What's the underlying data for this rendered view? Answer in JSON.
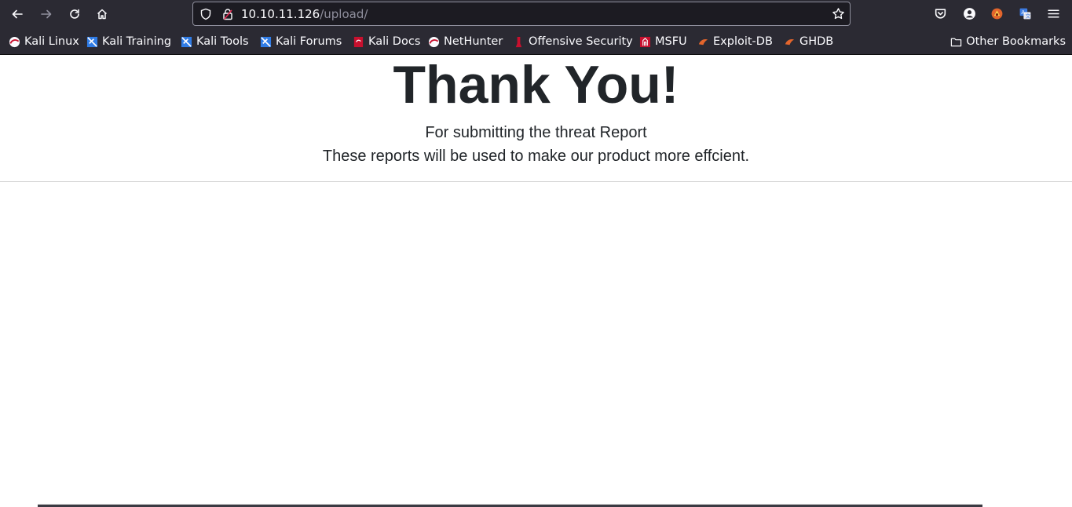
{
  "browser": {
    "url_host": "10.10.11.126",
    "url_path": "/upload/",
    "bookmarks": [
      {
        "label": "Kali Linux",
        "icon": "kali-linux-icon",
        "color": "#c8102e"
      },
      {
        "label": "Kali Training",
        "icon": "kali-training-icon",
        "color": "#2f7ce6"
      },
      {
        "label": "Kali Tools",
        "icon": "kali-tools-icon",
        "color": "#2f7ce6"
      },
      {
        "label": "Kali Forums",
        "icon": "kali-forums-icon",
        "color": "#2f7ce6"
      },
      {
        "label": "Kali Docs",
        "icon": "kali-docs-icon",
        "color": "#c8102e"
      },
      {
        "label": "NetHunter",
        "icon": "nethunter-icon",
        "color": "#c8102e"
      },
      {
        "label": "Offensive Security",
        "icon": "offensive-security-icon",
        "color": "#c8102e"
      },
      {
        "label": "MSFU",
        "icon": "msfu-icon",
        "color": "#c8102e"
      },
      {
        "label": "Exploit-DB",
        "icon": "exploit-db-icon",
        "color": "#e3652c"
      },
      {
        "label": "GHDB",
        "icon": "ghdb-icon",
        "color": "#e3652c"
      }
    ],
    "other_bookmarks": "Other Bookmarks"
  },
  "page": {
    "title": "Thank You!",
    "line1": "For submitting the threat Report",
    "line2": "These reports will be used to make our product more effcient."
  }
}
